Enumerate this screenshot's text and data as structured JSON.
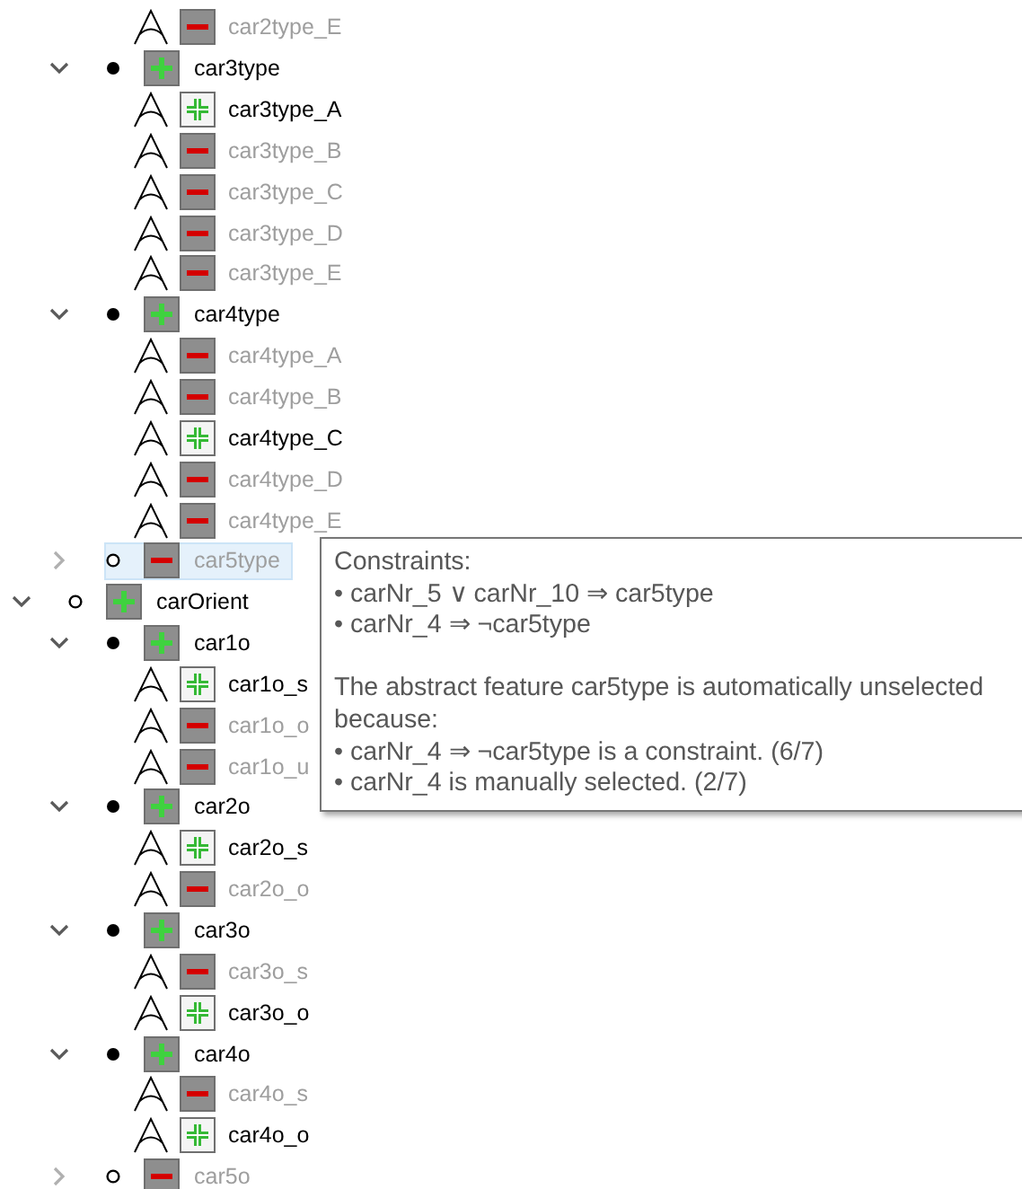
{
  "tree": [
    {
      "children": [
        {
          "children": [
            {
              "kind": "leaf",
              "label": "car2type_E",
              "selected": false,
              "manual": false
            }
          ]
        },
        {
          "kind": "group",
          "label": "car3type",
          "expanded": true,
          "mandatory": true,
          "selected": true,
          "manual": false,
          "children": [
            {
              "kind": "leaf",
              "label": "car3type_A",
              "selected": true,
              "manual": true
            },
            {
              "kind": "leaf",
              "label": "car3type_B",
              "selected": false,
              "manual": false
            },
            {
              "kind": "leaf",
              "label": "car3type_C",
              "selected": false,
              "manual": false
            },
            {
              "kind": "leaf",
              "label": "car3type_D",
              "selected": false,
              "manual": false
            },
            {
              "kind": "leaf",
              "label": "car3type_E",
              "selected": false,
              "manual": false
            }
          ]
        },
        {
          "kind": "group",
          "label": "car4type",
          "expanded": true,
          "mandatory": true,
          "selected": true,
          "manual": false,
          "children": [
            {
              "kind": "leaf",
              "label": "car4type_A",
              "selected": false,
              "manual": false
            },
            {
              "kind": "leaf",
              "label": "car4type_B",
              "selected": false,
              "manual": false
            },
            {
              "kind": "leaf",
              "label": "car4type_C",
              "selected": true,
              "manual": true
            },
            {
              "kind": "leaf",
              "label": "car4type_D",
              "selected": false,
              "manual": false
            },
            {
              "kind": "leaf",
              "label": "car4type_E",
              "selected": false,
              "manual": false
            }
          ]
        },
        {
          "kind": "group",
          "label": "car5type",
          "expanded": false,
          "mandatory": false,
          "selected": false,
          "manual": false,
          "hovered": true
        }
      ]
    },
    {
      "kind": "group",
      "label": "carOrient",
      "expanded": true,
      "mandatory": false,
      "selected": true,
      "manual": false,
      "children": [
        {
          "kind": "group",
          "label": "car1o",
          "expanded": true,
          "mandatory": true,
          "selected": true,
          "manual": false,
          "children": [
            {
              "kind": "leaf",
              "label": "car1o_s",
              "selected": true,
              "manual": true
            },
            {
              "kind": "leaf",
              "label": "car1o_o",
              "selected": false,
              "manual": false
            },
            {
              "kind": "leaf",
              "label": "car1o_u",
              "selected": false,
              "manual": false
            }
          ]
        },
        {
          "kind": "group",
          "label": "car2o",
          "expanded": true,
          "mandatory": true,
          "selected": true,
          "manual": false,
          "children": [
            {
              "kind": "leaf",
              "label": "car2o_s",
              "selected": true,
              "manual": true
            },
            {
              "kind": "leaf",
              "label": "car2o_o",
              "selected": false,
              "manual": false
            }
          ]
        },
        {
          "kind": "group",
          "label": "car3o",
          "expanded": true,
          "mandatory": true,
          "selected": true,
          "manual": false,
          "children": [
            {
              "kind": "leaf",
              "label": "car3o_s",
              "selected": false,
              "manual": false
            },
            {
              "kind": "leaf",
              "label": "car3o_o",
              "selected": true,
              "manual": true
            }
          ]
        },
        {
          "kind": "group",
          "label": "car4o",
          "expanded": true,
          "mandatory": true,
          "selected": true,
          "manual": false,
          "children": [
            {
              "kind": "leaf",
              "label": "car4o_s",
              "selected": false,
              "manual": false
            },
            {
              "kind": "leaf",
              "label": "car4o_o",
              "selected": true,
              "manual": true
            }
          ]
        },
        {
          "kind": "group",
          "label": "car5o",
          "expanded": false,
          "mandatory": false,
          "selected": false,
          "manual": false
        }
      ]
    }
  ],
  "tooltip": {
    "sections": [
      {
        "heading": "Constraints:",
        "bullets": [
          "• carNr_5 ∨ carNr_10 ⇒ car5type",
          "• carNr_4 ⇒ ¬car5type"
        ]
      },
      {
        "heading": "The abstract feature car5type is automatically unselected because:",
        "bullets": [
          "• carNr_4 ⇒ ¬car5type is a constraint. (6/7)",
          "• carNr_4 is manually selected. (2/7)"
        ]
      }
    ]
  }
}
